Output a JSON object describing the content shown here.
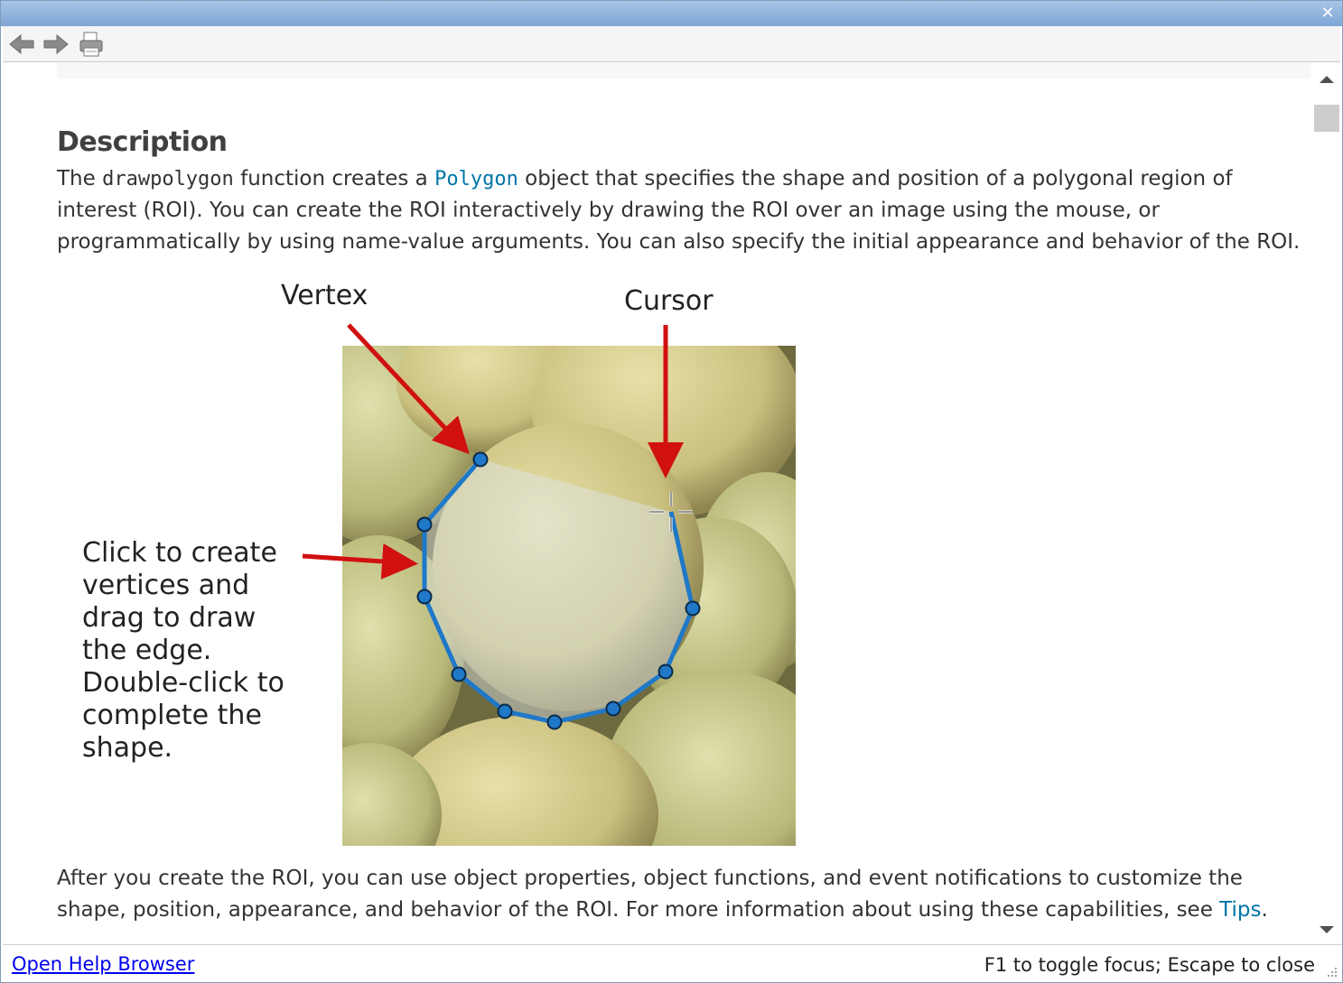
{
  "window": {
    "close_icon": "close-icon"
  },
  "toolbar": {
    "back_icon": "back-arrow-icon",
    "forward_icon": "forward-arrow-icon",
    "print_icon": "printer-icon"
  },
  "content": {
    "heading": "Description",
    "para1": {
      "t1": "The ",
      "code1": "drawpolygon",
      "t2": " function creates a ",
      "link1": "Polygon",
      "t3": " object that specifies the shape and position of a polygonal region of interest (ROI). You can create the ROI interactively by drawing the ROI over an image using the mouse, or programmatically by using name-value arguments. You can also specify the initial appearance and behavior of the ROI."
    },
    "figure": {
      "vertex_label": "Vertex",
      "cursor_label": "Cursor",
      "click_lines": [
        "Click to create",
        "vertices and",
        "drag to draw",
        "the edge.",
        "Double-click to",
        "complete the",
        "shape."
      ]
    },
    "para2": {
      "t1": "After you create the ROI, you can use object properties, object functions, and event notifications to customize the shape, position, appearance, and behavior of the ROI. For more information about using these capabilities, see ",
      "link": "Tips",
      "t2": "."
    }
  },
  "statusbar": {
    "open_help": "Open Help Browser",
    "hint": "F1 to toggle focus; Escape to close"
  },
  "colors": {
    "link": "#0076a8",
    "roi_blue": "#1f78c8",
    "arrow_red": "#d11010",
    "titlebar": "#7ea5d6"
  }
}
